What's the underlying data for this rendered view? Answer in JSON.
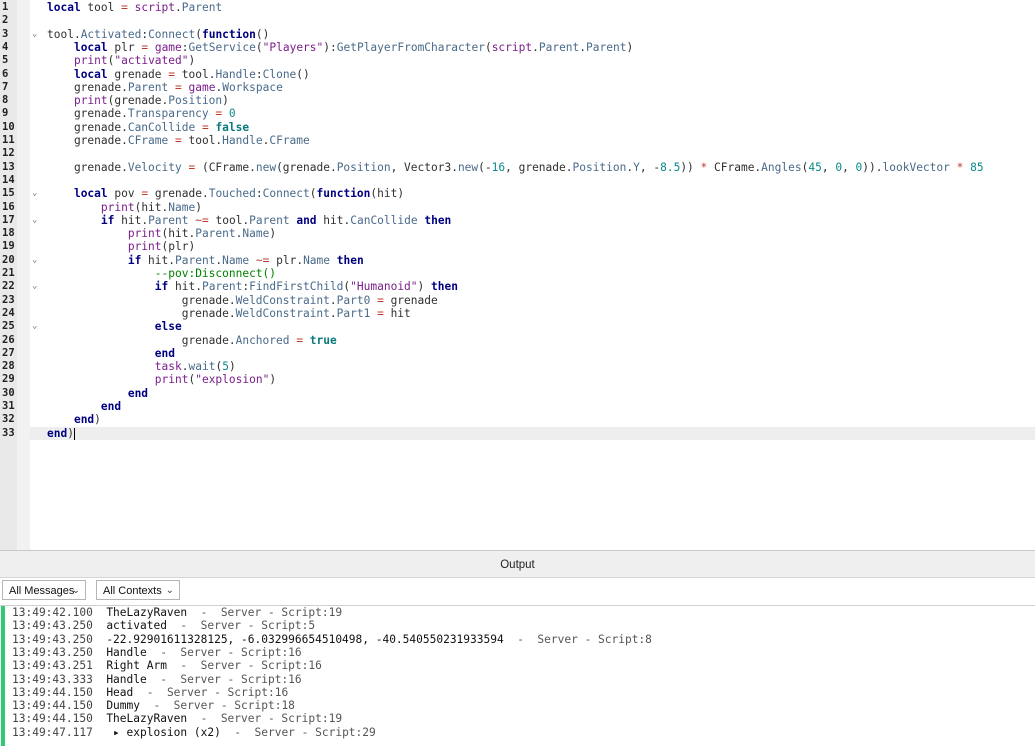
{
  "editor": {
    "line_numbers": [
      "1",
      "2",
      "3",
      "4",
      "5",
      "6",
      "7",
      "8",
      "9",
      "10",
      "11",
      "12",
      "13",
      "14",
      "15",
      "16",
      "17",
      "18",
      "19",
      "20",
      "21",
      "22",
      "23",
      "24",
      "25",
      "26",
      "27",
      "28",
      "29",
      "30",
      "31",
      "32",
      "33"
    ],
    "lines": [
      "local tool = script.Parent",
      "",
      "tool.Activated:Connect(function()",
      "    local plr = game:GetService(\"Players\"):GetPlayerFromCharacter(script.Parent.Parent)",
      "    print(\"activated\")",
      "    local grenade = tool.Handle:Clone()",
      "    grenade.Parent = game.Workspace",
      "    print(grenade.Position)",
      "    grenade.Transparency = 0",
      "    grenade.CanCollide = false",
      "    grenade.CFrame = tool.Handle.CFrame",
      "",
      "    grenade.Velocity = (CFrame.new(grenade.Position, Vector3.new(-16, grenade.Position.Y, -8.5)) * CFrame.Angles(45, 0, 0)).lookVector * 85",
      "",
      "    local pov = grenade.Touched:Connect(function(hit)",
      "        print(hit.Name)",
      "        if hit.Parent ~= tool.Parent and hit.CanCollide then",
      "            print(hit.Parent.Name)",
      "            print(plr)",
      "            if hit.Parent.Name ~= plr.Name then",
      "                --pov:Disconnect()",
      "                if hit.Parent:FindFirstChild(\"Humanoid\") then",
      "                    grenade.WeldConstraint.Part0 = grenade",
      "                    grenade.WeldConstraint.Part1 = hit",
      "                else",
      "                    grenade.Anchored = true",
      "                end",
      "                task.wait(5)",
      "                print(\"explosion\")",
      "            end",
      "        end",
      "    end)",
      "end)"
    ],
    "fold_marker": "⌄"
  },
  "output": {
    "title": "Output",
    "filter_messages": "All Messages",
    "filter_contexts": "All Contexts",
    "chevron": "⌄",
    "accent_color": "#2ecc71",
    "logs": [
      {
        "time": "13:49:42.100",
        "message": "TheLazyRaven",
        "source": "  -  Server - Script:19"
      },
      {
        "time": "13:49:43.250",
        "message": "activated",
        "source": "  -  Server - Script:5"
      },
      {
        "time": "13:49:43.250",
        "message": "-22.92901611328125, -6.032996654510498, -40.540550231933594",
        "source": "  -  Server - Script:8"
      },
      {
        "time": "13:49:43.250",
        "message": "Handle",
        "source": "  -  Server - Script:16"
      },
      {
        "time": "13:49:43.251",
        "message": "Right Arm",
        "source": "  -  Server - Script:16"
      },
      {
        "time": "13:49:43.333",
        "message": "Handle",
        "source": "  -  Server - Script:16"
      },
      {
        "time": "13:49:44.150",
        "message": "Head",
        "source": "  -  Server - Script:16"
      },
      {
        "time": "13:49:44.150",
        "message": "Dummy",
        "source": "  -  Server - Script:18"
      },
      {
        "time": "13:49:44.150",
        "message": "TheLazyRaven",
        "source": "  -  Server - Script:19"
      },
      {
        "time": "13:49:47.117",
        "message": " ▸ explosion (x2)",
        "source": "  -  Server - Script:29"
      }
    ]
  }
}
